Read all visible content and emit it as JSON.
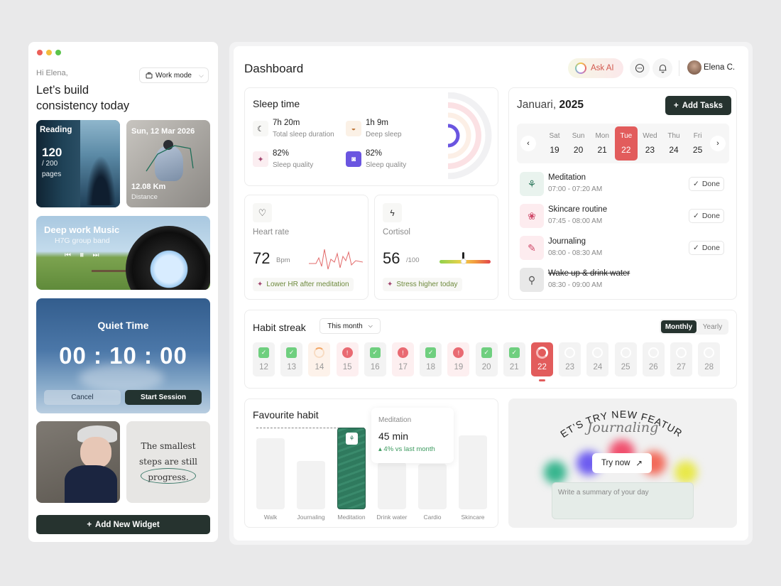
{
  "sidebar": {
    "greeting": "Hi Elena,",
    "headline_1": "Let’s build",
    "headline_2": "consistency today",
    "mode_button": "Work mode",
    "reading": {
      "label": "Reading",
      "count": "120",
      "total": "/ 200",
      "unit": "pages"
    },
    "run": {
      "date": "Sun, 12 Mar 2026",
      "distance": "12.08 Km",
      "distance_label": "Distance"
    },
    "music": {
      "title": "Deep work Music",
      "artist": "H7G group band"
    },
    "quiet": {
      "title": "Quiet Time",
      "timer": "00 : 10 : 00",
      "cancel": "Cancel",
      "start": "Start Session"
    },
    "quote": {
      "line1": "The smallest",
      "line2": "steps are still",
      "line3": "progress."
    },
    "add_widget": "Add New Widget"
  },
  "header": {
    "title": "Dashboard",
    "ask_ai": "Ask AI",
    "user": "Elena C."
  },
  "sleep": {
    "title": "Sleep time",
    "stats": [
      {
        "value": "7h 20m",
        "label": "Total sleep duration"
      },
      {
        "value": "1h 9m",
        "label": "Deep sleep"
      },
      {
        "value": "82%",
        "label": "Sleep quality"
      },
      {
        "value": "82%",
        "label": "Sleep quality"
      }
    ]
  },
  "heart": {
    "title": "Heart rate",
    "value": "72",
    "unit": "Bpm",
    "tip": "Lower HR after meditation"
  },
  "cortisol": {
    "title": "Cortisol",
    "value": "56",
    "unit": "/100",
    "tip": "Stress higher today"
  },
  "calendar": {
    "month": "Januari,",
    "year": "2025",
    "add": "Add Tasks",
    "days": [
      {
        "d": "Sat",
        "n": "19"
      },
      {
        "d": "Sun",
        "n": "20"
      },
      {
        "d": "Mon",
        "n": "21"
      },
      {
        "d": "Tue",
        "n": "22"
      },
      {
        "d": "Wed",
        "n": "23"
      },
      {
        "d": "Thu",
        "n": "24"
      },
      {
        "d": "Fri",
        "n": "25"
      }
    ],
    "tasks": [
      {
        "name": "Meditation",
        "time": "07:00 - 07:20 AM",
        "status": "Done"
      },
      {
        "name": "Skincare routine",
        "time": "07:45 - 08:00 AM",
        "status": "Done"
      },
      {
        "name": "Journaling",
        "time": "08:00 - 08:30 AM",
        "status": "Done"
      },
      {
        "name": "Wake up & drink water",
        "time": "08:30 - 09:00 AM",
        "status": ""
      }
    ]
  },
  "streak": {
    "title": "Habit streak",
    "filter": "This month",
    "monthly": "Monthly",
    "yearly": "Yearly",
    "days": [
      {
        "n": "12",
        "s": "done"
      },
      {
        "n": "13",
        "s": "done"
      },
      {
        "n": "14",
        "s": "partial"
      },
      {
        "n": "15",
        "s": "missed"
      },
      {
        "n": "16",
        "s": "done"
      },
      {
        "n": "17",
        "s": "missed"
      },
      {
        "n": "18",
        "s": "done"
      },
      {
        "n": "19",
        "s": "missed"
      },
      {
        "n": "20",
        "s": "done"
      },
      {
        "n": "21",
        "s": "done"
      },
      {
        "n": "22",
        "s": "today"
      },
      {
        "n": "23",
        "s": "future"
      },
      {
        "n": "24",
        "s": "future"
      },
      {
        "n": "25",
        "s": "future"
      },
      {
        "n": "26",
        "s": "future"
      },
      {
        "n": "27",
        "s": "future"
      },
      {
        "n": "28",
        "s": "future"
      }
    ]
  },
  "favourite": {
    "title": "Favourite habit",
    "tooltip_label": "Meditation",
    "tooltip_value": "45 min",
    "tooltip_delta": "4% vs last month",
    "bars": [
      {
        "label": "Walk"
      },
      {
        "label": "Journaling"
      },
      {
        "label": "Meditation"
      },
      {
        "label": "Drink water"
      },
      {
        "label": "Cardio"
      },
      {
        "label": "Skincare"
      }
    ]
  },
  "feature": {
    "line": "LET’S TRY NEW FEATURE",
    "name": "Journaling",
    "try": "Try now",
    "placeholder": "Write a summary of your day"
  },
  "colors": {
    "accent_red": "#e25c5c",
    "dark": "#26332f",
    "green": "#2f7a5e"
  }
}
